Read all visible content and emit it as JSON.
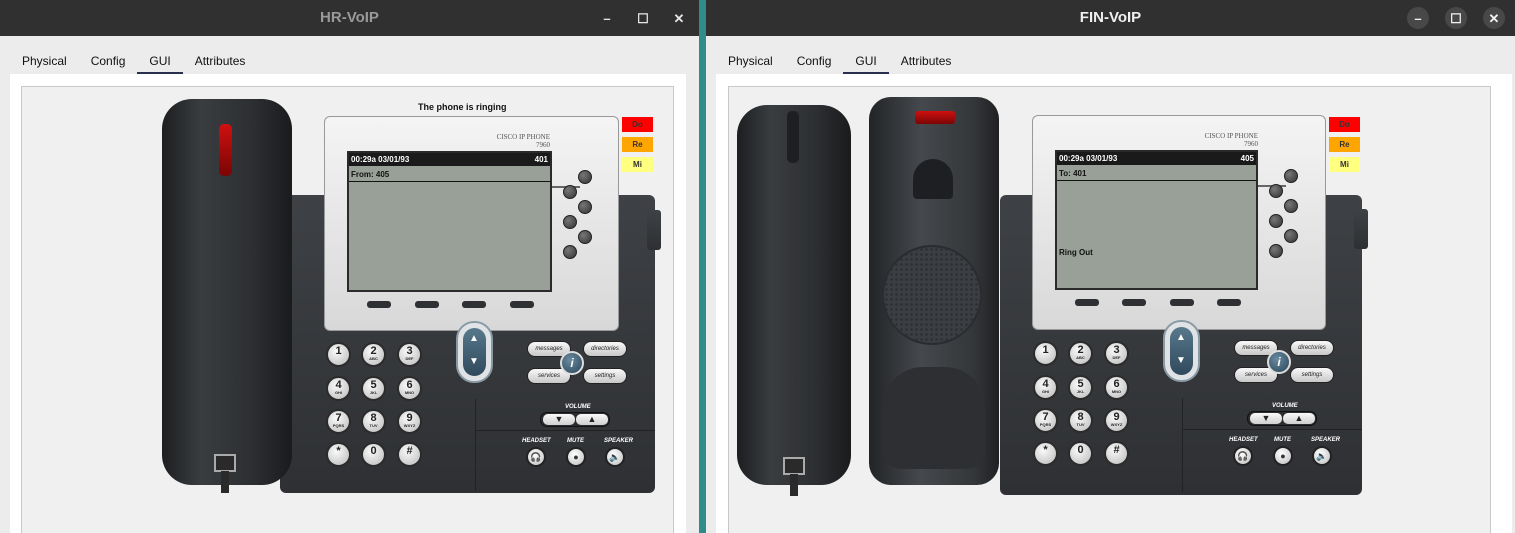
{
  "windows": [
    {
      "title": "HR-VoIP",
      "tabs": [
        "Physical",
        "Config",
        "GUI",
        "Attributes"
      ],
      "active_tab": "GUI",
      "status_message": "The phone is ringing",
      "side_buttons": [
        {
          "label": "Do",
          "color": "#ff0000"
        },
        {
          "label": "Re",
          "color": "#ffa500"
        },
        {
          "label": "Mi",
          "color": "#ffff80"
        }
      ],
      "brand": {
        "line1": "CISCO IP PHONE",
        "line2": "7960"
      },
      "screen": {
        "time": "00:29a 03/01/93",
        "extension": "401",
        "line": "From: 405",
        "message": ""
      }
    },
    {
      "title": "FIN-VoIP",
      "tabs": [
        "Physical",
        "Config",
        "GUI",
        "Attributes"
      ],
      "active_tab": "GUI",
      "status_message": "",
      "side_buttons": [
        {
          "label": "Do",
          "color": "#ff0000"
        },
        {
          "label": "Re",
          "color": "#ffa500"
        },
        {
          "label": "Mi",
          "color": "#ffff80"
        }
      ],
      "brand": {
        "line1": "CISCO IP PHONE",
        "line2": "7960"
      },
      "screen": {
        "time": "00:29a 03/01/93",
        "extension": "405",
        "line": "To: 401",
        "message": "Ring Out"
      }
    }
  ],
  "window_controls": {
    "minimize": "–",
    "maximize": "☐",
    "close": "✕"
  },
  "keypad": [
    {
      "digit": "1",
      "letters": ""
    },
    {
      "digit": "2",
      "letters": "ABC"
    },
    {
      "digit": "3",
      "letters": "DEF"
    },
    {
      "digit": "4",
      "letters": "GHI"
    },
    {
      "digit": "5",
      "letters": "JKL"
    },
    {
      "digit": "6",
      "letters": "MNO"
    },
    {
      "digit": "7",
      "letters": "PQRS"
    },
    {
      "digit": "8",
      "letters": "TUV"
    },
    {
      "digit": "9",
      "letters": "WXYZ"
    },
    {
      "digit": "*",
      "letters": ""
    },
    {
      "digit": "0",
      "letters": ""
    },
    {
      "digit": "#",
      "letters": ""
    }
  ],
  "function_keys": {
    "messages": "messages",
    "directories": "directories",
    "services": "services",
    "settings": "settings",
    "info": "i"
  },
  "volume": {
    "label": "VOLUME",
    "down": "▼",
    "up": "▲"
  },
  "bottom_keys": {
    "headset": "HEADSET",
    "mute": "MUTE",
    "speaker": "SPEAKER"
  }
}
